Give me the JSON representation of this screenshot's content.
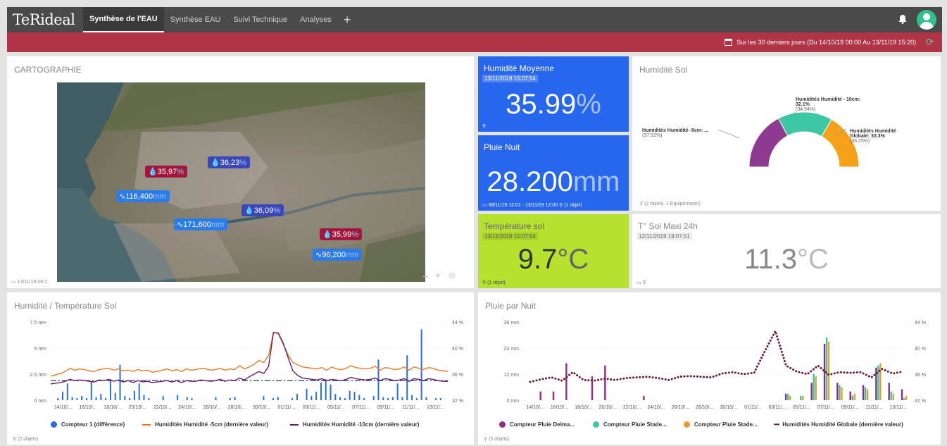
{
  "header": {
    "logo": "TeRideal",
    "tabs": [
      {
        "label": "Synthèse de l'EAU"
      },
      {
        "label": "Synthèse EAU"
      },
      {
        "label": "Suivi Technique"
      },
      {
        "label": "Analyses"
      }
    ],
    "add": "+"
  },
  "period": {
    "text": "Sur les 30 derniers jours (Du 14/10/19 00:00 Au 13/11/19 15:20)"
  },
  "carto": {
    "title": "CARTOGRAPHIE",
    "timestamp": "13/11/19 09:2",
    "badges": [
      {
        "value": "35,97",
        "unit": "%",
        "kind": "humidity",
        "color": "#a4163b"
      },
      {
        "value": "36,23",
        "unit": "%",
        "kind": "humidity",
        "color": "#3a47b8"
      },
      {
        "value": "116,400",
        "unit": "mm",
        "kind": "rain",
        "color": "#2b7ce8"
      },
      {
        "value": "36,09",
        "unit": "%",
        "kind": "humidity",
        "color": "#3a47b8"
      },
      {
        "value": "171,600",
        "unit": "mm",
        "kind": "rain",
        "color": "#2b7ce8"
      },
      {
        "value": "35,99",
        "unit": "%",
        "kind": "humidity",
        "color": "#a4163b"
      },
      {
        "value": "96,200",
        "unit": "mm",
        "kind": "rain",
        "color": "#2b7ce8"
      }
    ]
  },
  "kpi_humidite": {
    "title": "Humidité Moyenne",
    "date": "13/11/2019 15:07:54",
    "value": "35.99",
    "unit": "%"
  },
  "kpi_pluie": {
    "title": "Pluie Nuit",
    "value": "28.200",
    "unit": "mm",
    "footer": "08/11/19 12:01 - 13/11/19 12:00",
    "footer2": "(1 objet)"
  },
  "kpi_temp": {
    "title": "Température sol",
    "date": "13/11/2019 15:07:54",
    "value": "9.7",
    "unit": "°C",
    "footer": "(1 objet)"
  },
  "kpi_tmax": {
    "title": "T° Sol Maxi 24h",
    "date": "12/11/2019 19:07:51",
    "value": "11.3",
    "unit": "°C"
  },
  "humsol": {
    "title": "Humidité Sol",
    "footer": "(2 objets, 2 Equipements)",
    "labels": [
      {
        "name": "Humidités Humidité -5cm: ...",
        "pct": "(37.52%)"
      },
      {
        "name": "Humidités Humidité - 10cm: 32.1%",
        "pct": "(34.94%)"
      },
      {
        "name": "Humidités Humidité Globale: 33.3%",
        "pct": "(36.25%)"
      }
    ]
  },
  "chart_data": [
    {
      "type": "bar",
      "title": "Humidité / Température Sol",
      "yleft": [
        "7.5 mm",
        "5 mm",
        "2.5 mm",
        "0 mm"
      ],
      "yleft_range": [
        0,
        7.5
      ],
      "yright": [
        "44 %",
        "40 %",
        "36 %",
        "32 %"
      ],
      "yright_range": [
        32,
        44
      ],
      "xticks": [
        "14/10/...",
        "16/10/...",
        "18/10/...",
        "20/10/...",
        "22/10/...",
        "24/10/...",
        "26/10/...",
        "28/10/...",
        "30/10/...",
        "01/11/...",
        "03/11/...",
        "05/11/...",
        "07/11/...",
        "09/11/...",
        "11/11/...",
        "13/11/..."
      ],
      "series": [
        {
          "name": "Compteur 1 (différence)",
          "type": "bar",
          "color": "#2a6de0",
          "values": [
            0,
            0.2,
            0.8,
            1.6,
            0.3,
            0.2,
            0.4,
            0.2,
            1.8,
            0.3,
            0.6,
            0.2,
            2.0,
            0.7,
            3.4,
            0.4,
            0.2,
            0.9,
            1.6,
            0.5,
            0.2,
            0,
            0,
            0.4,
            0,
            0,
            0.5,
            0,
            0.3,
            0.2,
            0,
            0,
            0,
            0,
            0.3,
            0,
            0,
            0.2,
            0.3,
            0,
            0,
            0,
            0,
            0,
            0.4,
            0,
            0.2,
            0.3,
            0,
            0,
            0.2,
            0.6,
            0,
            1.1,
            0.4,
            0.8,
            1.7,
            2.0,
            1.5,
            0.6,
            0.3,
            0.2,
            0.9,
            0.8,
            0.5,
            0.2,
            0,
            0.4,
            3.9,
            0.3,
            0.2,
            0.3,
            1.6,
            0.3,
            4.3,
            0.5,
            0.2,
            6.8,
            0.3,
            0,
            0.2,
            0.2,
            0
          ]
        },
        {
          "name": "Humidités Humidité -5cm (dernière valeur)",
          "type": "line",
          "color": "#e47c2c",
          "values": [
            35.7,
            35.9,
            36.1,
            36.4,
            36.9,
            36.6,
            36.8,
            36.7,
            36.5,
            36.4,
            36.7,
            36.8,
            36.9,
            36.6,
            36.8,
            36.5,
            36.6,
            36.4,
            36.7,
            36.5,
            36.6,
            36.3,
            36.4,
            36.6,
            36.8,
            36.5,
            36.7,
            36.4,
            36.8,
            36.6,
            36.7,
            36.9,
            36.8,
            36.6,
            36.7,
            36.9,
            36.6,
            36.8,
            36.7,
            37.3,
            36.8,
            37.1,
            37.5,
            38.1,
            37.8,
            38.9,
            42.4,
            42.2,
            40.6,
            39.0,
            37.8,
            37.4,
            37.1,
            37.0,
            36.9,
            36.8,
            37.0,
            36.6,
            37.1,
            36.8,
            36.7,
            36.9,
            37.3,
            37.0,
            36.9,
            36.8,
            36.9,
            37.2,
            36.6,
            37.0,
            36.9,
            36.7,
            36.8,
            37.1,
            36.6,
            37.1,
            36.9,
            36.7,
            37.0,
            36.9,
            36.6,
            36.5,
            36.4
          ]
        },
        {
          "name": "Humidités Humidité -10cm (dernière valeur)",
          "type": "line",
          "color": "#6a1d5e",
          "values": [
            34.5,
            34.6,
            34.7,
            34.9,
            35.2,
            35.0,
            35.1,
            35.0,
            34.9,
            34.8,
            35.1,
            35.0,
            35.2,
            34.9,
            35.1,
            34.8,
            35.0,
            34.7,
            35.0,
            34.8,
            34.9,
            34.7,
            34.8,
            34.9,
            35.0,
            34.8,
            35.0,
            34.7,
            35.0,
            34.9,
            34.9,
            35.1,
            35.0,
            34.9,
            35.0,
            35.2,
            34.9,
            35.1,
            35.0,
            35.4,
            35.1,
            35.6,
            36.0,
            36.4,
            36.1,
            37.2,
            42.4,
            42.3,
            40.8,
            38.6,
            36.5,
            35.8,
            35.4,
            35.3,
            35.2,
            35.1,
            35.3,
            35.0,
            35.2,
            35.1,
            35.0,
            35.2,
            35.5,
            35.3,
            35.2,
            35.1,
            35.2,
            35.4,
            35.0,
            35.3,
            35.2,
            35.0,
            35.1,
            35.3,
            34.9,
            35.3,
            35.2,
            35.0,
            35.3,
            35.2,
            35.0,
            34.9,
            34.9
          ]
        },
        {
          "name": "",
          "type": "dash-dot",
          "color": "#1f3a8a",
          "values": [
            35.0
          ]
        }
      ],
      "legend": "bottom",
      "footer": "(2 objets)"
    },
    {
      "type": "bar",
      "title": "Pluie par Nuit",
      "yleft": [
        "36 mm",
        "24 mm",
        "12 mm",
        "0 mm"
      ],
      "yleft_range": [
        0,
        36
      ],
      "yright": [
        "44 %",
        "40 %",
        "36 %",
        "32 %"
      ],
      "yright_range": [
        32,
        44
      ],
      "xticks": [
        "14/10/...",
        "16/10/...",
        "18/10/...",
        "20/10/...",
        "22/10/...",
        "24/10/...",
        "26/10/...",
        "28/10/...",
        "30/10/...",
        "01/11/...",
        "03/11/...",
        "05/11/...",
        "07/11/...",
        "09/11/...",
        "11/11/...",
        "13/11/..."
      ],
      "categories": 30,
      "series": [
        {
          "name": "Compteur Pluie Delma...",
          "type": "bar",
          "color": "#8e2d88",
          "values": [
            0,
            4,
            4,
            17,
            0,
            11,
            16,
            0,
            0,
            2,
            0,
            0,
            0,
            0,
            0,
            0,
            0,
            0,
            0,
            0,
            3,
            0,
            8,
            26,
            8,
            4,
            7,
            15,
            8,
            5
          ]
        },
        {
          "name": "Compteur Pluie Stade...",
          "type": "bar",
          "color": "#3dc4a2",
          "values": [
            0,
            0,
            0,
            0,
            0,
            0,
            0,
            0,
            0,
            0,
            0,
            0,
            0,
            0,
            0,
            0,
            0,
            0,
            0,
            0,
            3,
            2,
            12,
            29,
            7,
            2,
            6,
            16,
            4,
            1
          ]
        },
        {
          "name": "Compteur Pluie Stade...",
          "type": "bar",
          "color": "#f29b24",
          "values": [
            0,
            0,
            0,
            0,
            0,
            0,
            0,
            0,
            0,
            0,
            0,
            0,
            0,
            0,
            0,
            0,
            0,
            0,
            0,
            0,
            2,
            2,
            11,
            27,
            6,
            3,
            5,
            17,
            3,
            2
          ]
        },
        {
          "name": "Humidités Humidité Globale (dernière valeur)",
          "type": "dotted-line",
          "color": "#6a1a3a",
          "values": [
            34.8,
            35.2,
            35.5,
            35.0,
            36.3,
            35.1,
            35.0,
            35.3,
            35.1,
            35.4,
            35.5,
            35.6,
            35.4,
            35.1,
            35.6,
            35.7,
            35.6,
            35.5,
            36.1,
            36.3,
            36.0,
            36.2,
            39.5,
            42.6,
            37.3,
            36.4,
            36.0,
            37.3,
            35.9,
            36.3,
            36.2,
            36.3,
            35.5,
            36.8,
            36.1,
            36.4
          ]
        }
      ],
      "legend": "bottom",
      "footer": "(5 objets)"
    }
  ]
}
